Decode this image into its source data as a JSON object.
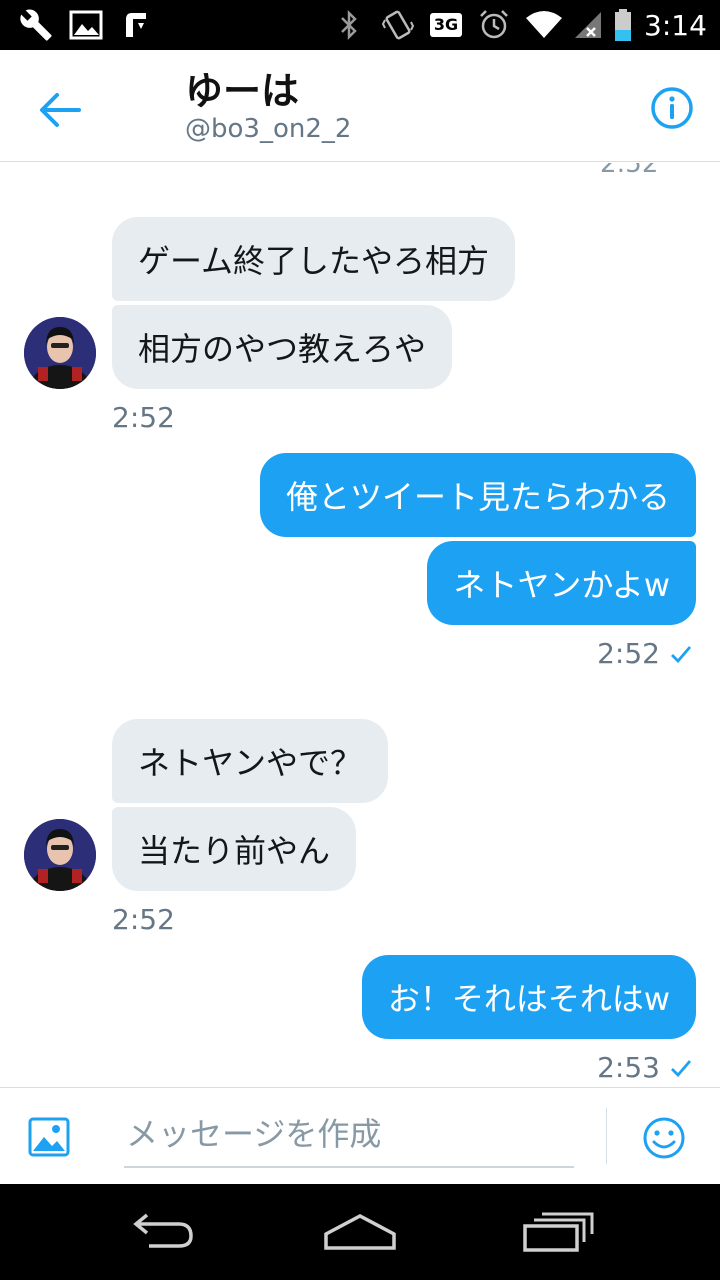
{
  "status_bar": {
    "time": "3:14",
    "network": "3G",
    "icons": [
      "wrench-icon",
      "image-icon",
      "download-icon",
      "bluetooth-icon",
      "vibrate-icon",
      "network-3g-icon",
      "alarm-icon",
      "wifi-icon",
      "cell-signal-icon",
      "battery-icon"
    ]
  },
  "header": {
    "name": "ゆーは",
    "handle": "@bo3_on2_2",
    "back_icon": "arrow-left-icon",
    "info_icon": "info-icon"
  },
  "conversation": {
    "cut_timestamp": "2:52",
    "groups": [
      {
        "sender": "them",
        "messages": [
          "ゲーム終了したやろ相方",
          "相方のやつ教えろや"
        ],
        "time": "2:52"
      },
      {
        "sender": "me",
        "messages": [
          "俺とツイート見たらわかる",
          "ネトヤンかよw"
        ],
        "time": "2:52",
        "read_receipt": "checkmark-icon"
      },
      {
        "sender": "them",
        "messages": [
          "ネトヤンやで？",
          "当たり前やん"
        ],
        "time": "2:52"
      },
      {
        "sender": "me",
        "messages": [
          "お！それはそれはw"
        ],
        "time": "2:53",
        "read_receipt": "checkmark-icon"
      }
    ]
  },
  "composer": {
    "placeholder": "メッセージを作成",
    "value": "",
    "media_icon": "image-icon",
    "emoji_icon": "smiley-icon"
  },
  "nav_bar": {
    "icons": [
      "back-nav-icon",
      "home-nav-icon",
      "recents-nav-icon"
    ]
  },
  "colors": {
    "accent": "#1da1f2",
    "incoming_bubble": "#e6ecf0",
    "muted_text": "#657786"
  }
}
